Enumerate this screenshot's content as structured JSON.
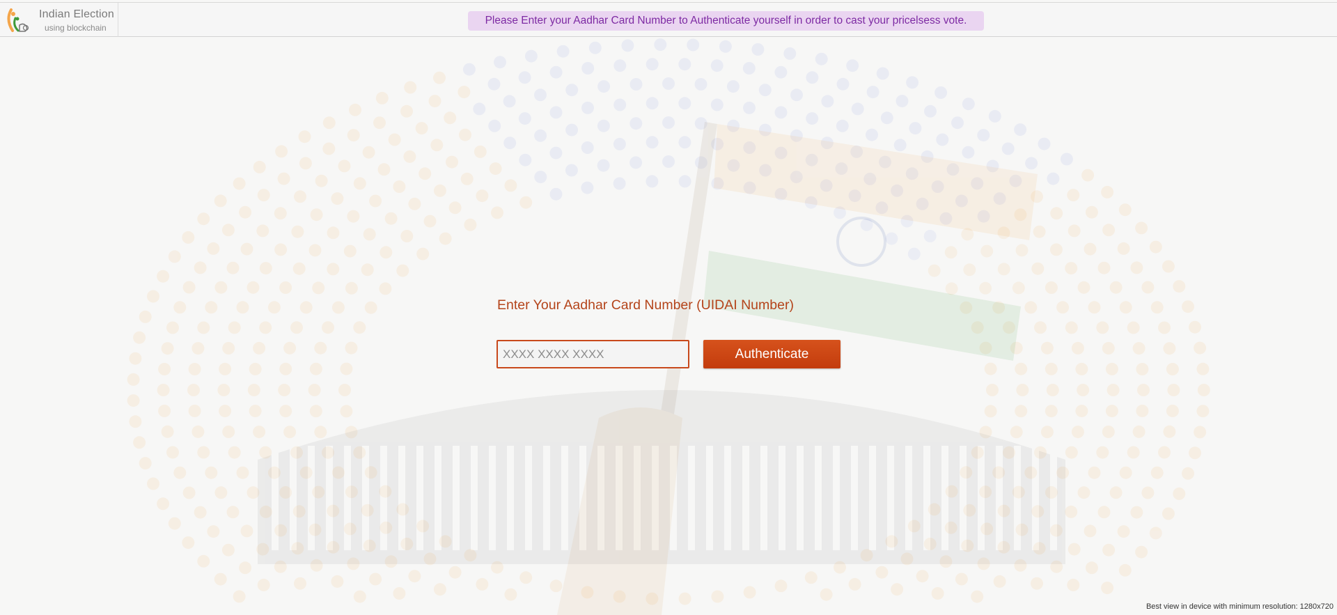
{
  "brand": {
    "title": "Indian Election",
    "subtitle": "using blockchain"
  },
  "header": {
    "notice": "Please Enter your Aadhar Card Number to Authenticate yourself in order to cast your pricelsess vote."
  },
  "form": {
    "label": "Enter Your Aadhar Card Number (UIDAI Number)",
    "input_placeholder": "XXXX XXXX XXXX",
    "input_value": "",
    "button_label": "Authenticate"
  },
  "footer": {
    "note": "Best view in device with minimum resolution: 1280x720"
  },
  "colors": {
    "accent": "#c8481b",
    "notice_bg": "#ead5f1",
    "notice_text": "#7d2aa3",
    "saffron": "#f4a54a",
    "green": "#3f9a3a",
    "blue": "#7a8ee0"
  }
}
